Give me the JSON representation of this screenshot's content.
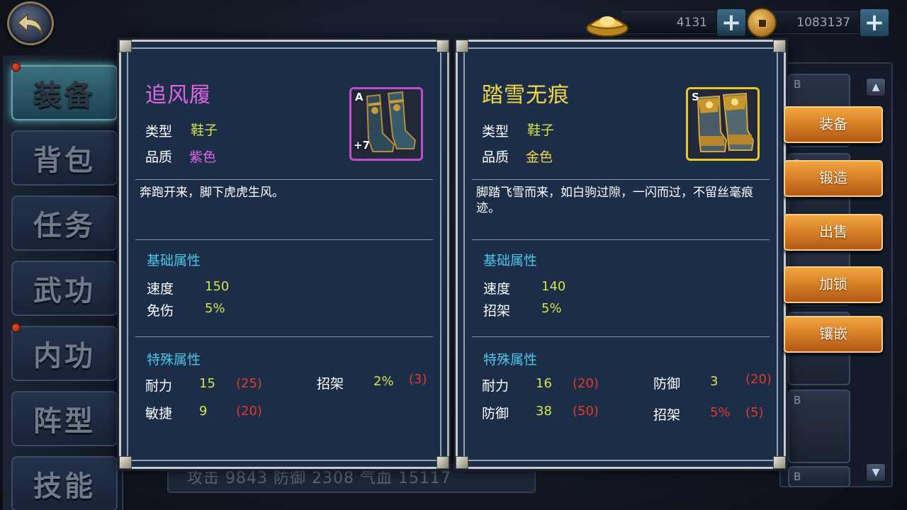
{
  "top_bar": {
    "back_icon": "back-arrow-icon",
    "ingot_amount": "4131",
    "coin_amount": "1083137",
    "plus_label": "+"
  },
  "left_tabs": [
    {
      "label": "装备",
      "active": true,
      "dot": true
    },
    {
      "label": "背包",
      "active": false,
      "dot": false
    },
    {
      "label": "任务",
      "active": false,
      "dot": false
    },
    {
      "label": "武功",
      "active": false,
      "dot": false
    },
    {
      "label": "内功",
      "active": false,
      "dot": true
    },
    {
      "label": "阵型",
      "active": false,
      "dot": false
    },
    {
      "label": "技能",
      "active": false,
      "dot": false
    }
  ],
  "bottom_strip": "攻击 9843 防御 2308 气血 15117",
  "inventory_badge": "B",
  "actions": [
    "装备",
    "锻造",
    "出售",
    "加锁",
    "镶嵌"
  ],
  "left_item": {
    "name": "追风履",
    "name_color": "#e066e6",
    "type_label": "类型",
    "type_value": "鞋子",
    "quality_label": "品质",
    "quality_value": "紫色",
    "quality_color": "#e066e6",
    "grade": "A",
    "enhance": "+7",
    "frame_color": "#c050c8",
    "description": "奔跑开来，脚下虎虎生风。",
    "basic_title": "基础属性",
    "basic": [
      {
        "name": "速度",
        "value": "150"
      },
      {
        "name": "免伤",
        "value": "5%"
      }
    ],
    "special_title": "特殊属性",
    "special": [
      {
        "name": "耐力",
        "value": "15",
        "extra": "(25)"
      },
      {
        "name": "招架",
        "value": "2%",
        "extra": "(3)"
      },
      {
        "name": "敏捷",
        "value": "9",
        "extra": "(20)"
      }
    ]
  },
  "right_item": {
    "name": "踏雪无痕",
    "name_color": "#f0d64a",
    "type_label": "类型",
    "type_value": "鞋子",
    "quality_label": "品质",
    "quality_value": "金色",
    "quality_color": "#f0d64a",
    "grade": "S",
    "frame_color": "#e8c828",
    "description": "脚踏飞雪而来，如白驹过隙，一闪而过，不留丝毫痕迹。",
    "basic_title": "基础属性",
    "basic": [
      {
        "name": "速度",
        "value": "140"
      },
      {
        "name": "招架",
        "value": "5%"
      }
    ],
    "special_title": "特殊属性",
    "special": [
      {
        "name": "耐力",
        "value": "16",
        "extra": "(20)"
      },
      {
        "name": "防御",
        "value": "3",
        "extra": "(20)"
      },
      {
        "name": "防御",
        "value": "38",
        "extra": "(50)"
      },
      {
        "name": "招架",
        "value": "5%",
        "extra": "(5)",
        "value_red": true
      }
    ]
  }
}
